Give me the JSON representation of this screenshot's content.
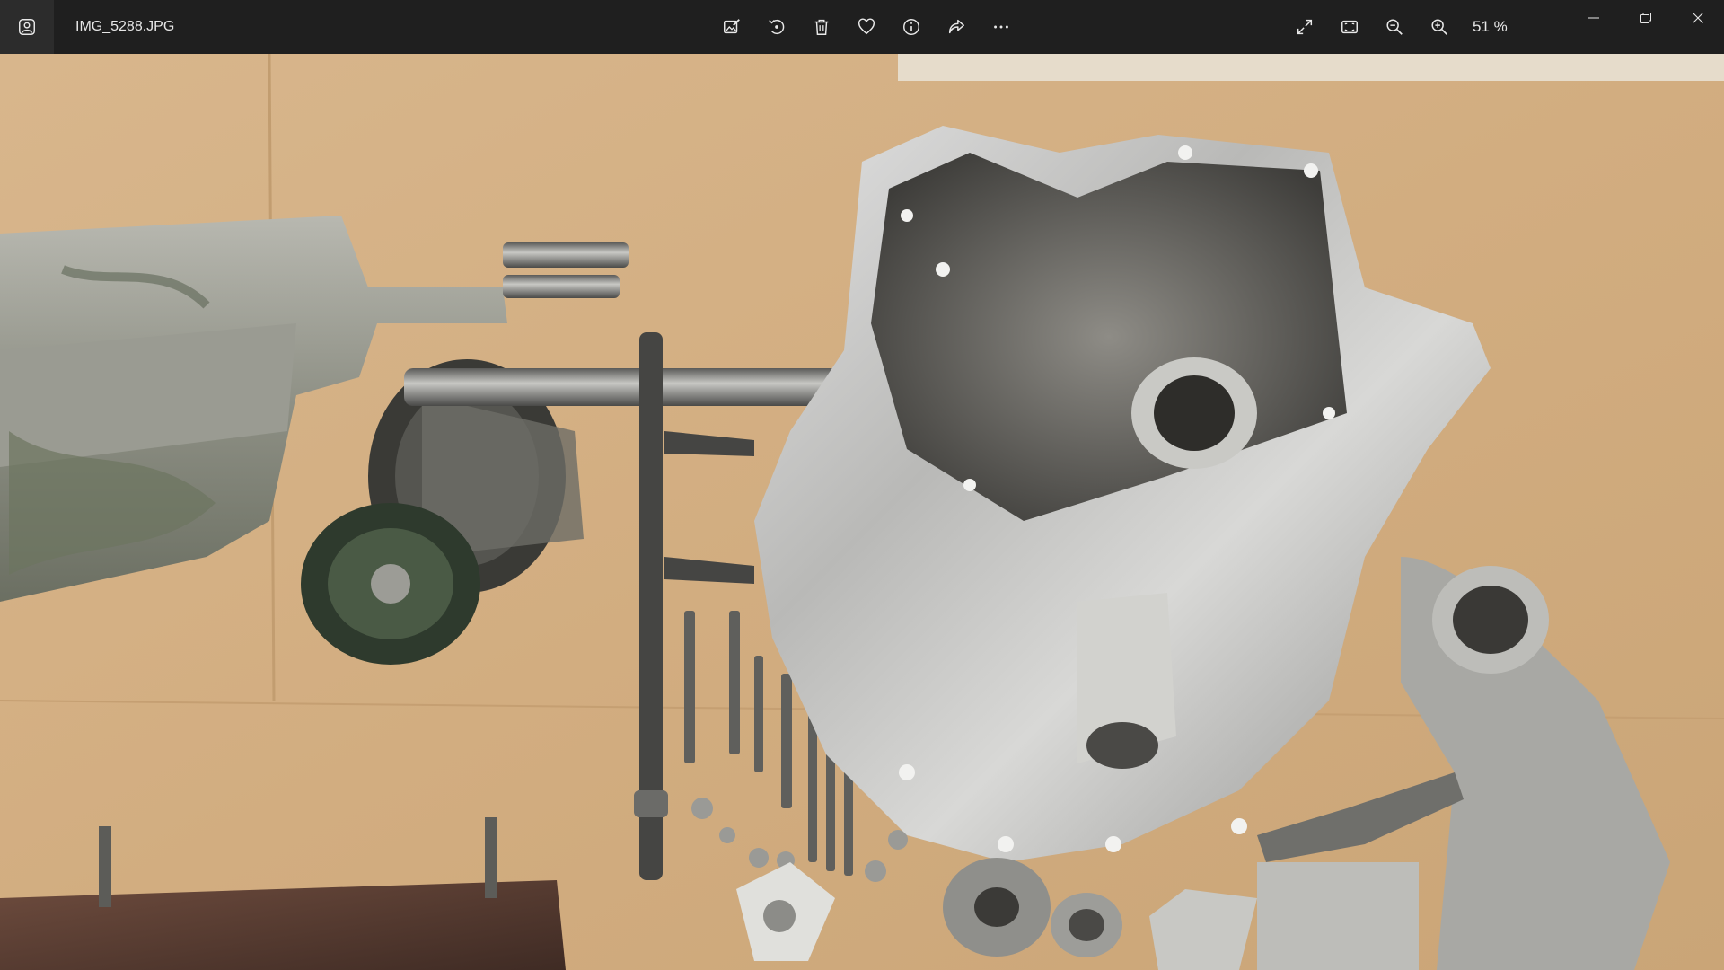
{
  "window": {
    "filename": "IMG_5288.JPG"
  },
  "toolbar": {
    "icons": [
      "edit-image-icon",
      "rotate-icon",
      "delete-icon",
      "favorite-icon",
      "info-icon",
      "share-icon",
      "more-icon"
    ],
    "right_icons": [
      "fullscreen-icon",
      "fit-to-window-icon",
      "zoom-out-icon",
      "zoom-in-icon"
    ],
    "zoom_level": "51 %"
  },
  "window_controls": [
    "minimize-icon",
    "restore-icon",
    "close-icon"
  ],
  "photo": {
    "subject": "disassembled transmission parts on cardboard",
    "colors": {
      "cardboard": "#d6b48a",
      "aluminum": "#c9c9c9",
      "dark_metal": "#4a4a48",
      "rust": "#5e3f33"
    }
  }
}
